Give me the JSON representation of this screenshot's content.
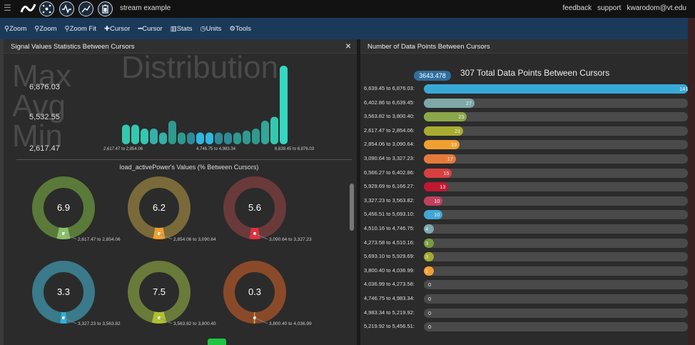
{
  "topbar": {
    "app_name": "stream example",
    "links": [
      "feedback",
      "support",
      "kwarodom@vt.edu"
    ],
    "icons": [
      "app-logo-icon",
      "network-icon",
      "pulse-icon",
      "chart-icon",
      "battery-icon"
    ]
  },
  "toolbar": {
    "items": [
      {
        "icon": "search-icon",
        "label": "Zoom"
      },
      {
        "icon": "search-icon",
        "label": "Zoom"
      },
      {
        "icon": "search-icon",
        "label": "Zoom Fit"
      },
      {
        "icon": "plus-icon",
        "label": "Cursor"
      },
      {
        "icon": "minus-icon",
        "label": "Cursor"
      },
      {
        "icon": "bar-chart-icon",
        "label": "Stats"
      },
      {
        "icon": "clock-icon",
        "label": "Units"
      },
      {
        "icon": "gear-icon",
        "label": "Tools"
      }
    ]
  },
  "left_panel": {
    "title": "Signal Values Statistics Between Cursors",
    "close": "×",
    "stats": {
      "max_label": "Max",
      "max_value": "6,876.03",
      "avg_label": "Avg",
      "avg_value": "5,532.55",
      "min_label": "Min",
      "min_value": "2,617.47"
    },
    "distribution_label": "Distribution",
    "distribution_ticks": [
      "2,617.47 to 2,854.06",
      "4,746.75 to 4,983.34",
      "6,639.45 to 6,876.03"
    ],
    "donut_title": "load_activePower's Values (% Between Cursors)",
    "donuts": [
      {
        "value": "6.9",
        "range": "2,617.47 to 2,854.06",
        "color": "#5a7a3a",
        "accent": "#8bc06a",
        "pct": 6.9
      },
      {
        "value": "6.2",
        "range": "2,854.06 to 3,090.64",
        "color": "#7a6a3a",
        "accent": "#f0a030",
        "pct": 6.2
      },
      {
        "value": "5.6",
        "range": "3,090.64 to 3,327.23",
        "color": "#6a3a3a",
        "accent": "#e03040",
        "pct": 5.6
      },
      {
        "value": "3.3",
        "range": "3,327.23 to 3,563.82",
        "color": "#3a7a8a",
        "accent": "#30b0e0",
        "pct": 3.3
      },
      {
        "value": "7.5",
        "range": "3,563.82 to 3,800.40",
        "color": "#6a7a3a",
        "accent": "#b0c030",
        "pct": 7.5
      },
      {
        "value": "0.3",
        "range": "3,800.40 to 4,036.99",
        "color": "#8a4a2a",
        "accent": "#f0a030",
        "pct": 0.3
      }
    ]
  },
  "right_panel": {
    "title": "Number of Data Points Between Cursors",
    "summary": "307 Total Data Points Between Cursors",
    "badge": "3643.478",
    "chart_data": {
      "type": "bar",
      "orientation": "horizontal",
      "title": "307 Total Data Points Between Cursors",
      "xlim": [
        0,
        141
      ],
      "categories": [
        "6,639.45 to 6,876.03:",
        "6,402.86 to 6,639.45:",
        "3,563.82 to 3,800.40:",
        "2,617.47 to 2,854.06:",
        "2,854.06 to 3,090.64:",
        "3,090.64 to 3,327.23:",
        "6,566.27 to 6,402.86:",
        "5,929.69 to 6,166.27:",
        "3,327.23 to 3,563.82:",
        "5,456.51 to 5,693.10:",
        "4,510.16 to 4,746.75:",
        "4,273.58 to 4,510.16:",
        "5,693.10 to 5,929.69:",
        "3,800.40 to 4,036.99:",
        "4,036.99 to 4,273.58:",
        "4,746.75 to 4,983.34:",
        "4,983.34 to 5,219.92:",
        "5,219.92 to 5,456.51:"
      ],
      "values": [
        141,
        27,
        23,
        21,
        19,
        17,
        15,
        13,
        10,
        10,
        4,
        3,
        3,
        1,
        0,
        0,
        0,
        0
      ],
      "colors": [
        "#38a9d6",
        "#7fa8a8",
        "#8aa84a",
        "#a8ac30",
        "#f0a030",
        "#e67a3a",
        "#d84040",
        "#c01830",
        "#c04060",
        "#40a8d6",
        "#7fa8b0",
        "#7a9a40",
        "#a0ac30",
        "#f0a030",
        "#4a4a4a",
        "#4a4a4a",
        "#4a4a4a",
        "#4a4a4a"
      ]
    }
  },
  "distribution_data": {
    "type": "bar",
    "values": [
      10,
      10,
      8,
      8,
      6,
      12,
      6,
      6,
      6,
      6,
      6,
      6,
      6,
      7,
      8,
      12,
      14,
      40
    ],
    "colors": [
      "#35c7b0",
      "#35c7b0",
      "#35c7b0",
      "#35b0a8",
      "#35b0a8",
      "#2f9a90",
      "#2f9a90",
      "#2f8a98",
      "#2fb8e0",
      "#2fb8e0",
      "#2f8a98",
      "#2f8a98",
      "#2f9a90",
      "#2f9a90",
      "#2f9a90",
      "#2fa898",
      "#35c7b0",
      "#35d8c0"
    ]
  }
}
